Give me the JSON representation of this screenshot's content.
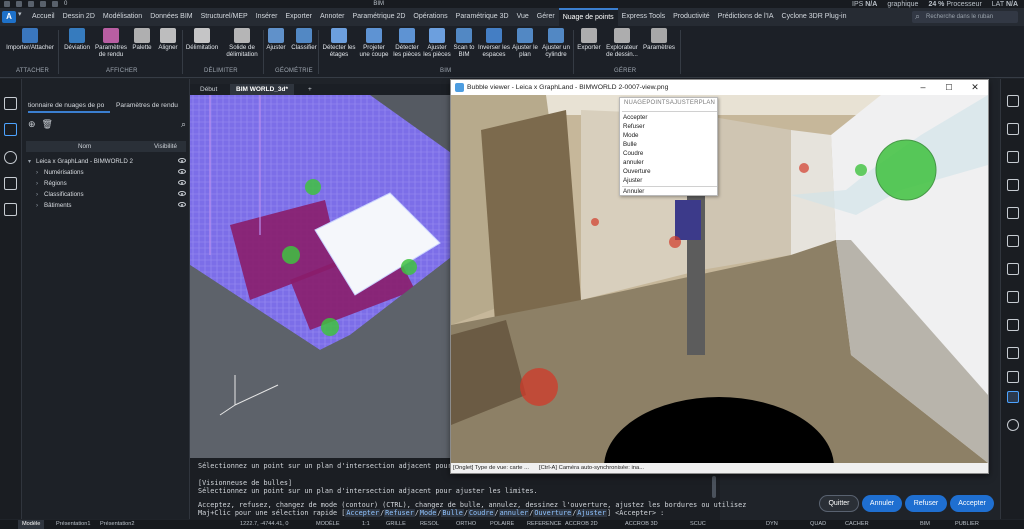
{
  "app": {
    "file_label": "BIM",
    "quick_access_value": "0",
    "top_right_fps": "IPS",
    "top_right_na": "N/A",
    "top_right_graphic": "graphique",
    "processor_label": "Processeur",
    "processor_pct": "24 %",
    "lat_label": "LAT",
    "lat_value": "N/A"
  },
  "ribbon_tabs": [
    "Accueil",
    "Dessin 2D",
    "Modélisation",
    "Données BIM",
    "Structurel/MEP",
    "Insérer",
    "Exporter",
    "Annoter",
    "Paramétrique 2D",
    "Opérations",
    "Paramétrique 3D",
    "Vue",
    "Gérer",
    "Nuage de points",
    "Express Tools",
    "Productivité",
    "Prédictions de l'IA",
    "Cyclone 3DR Plug-in"
  ],
  "active_tab": "Nuage de points",
  "search_placeholder": "Recherche dans le ruban",
  "ribbon": {
    "tools": [
      {
        "label": "Importer/Attacher"
      },
      {
        "label": "Déviation"
      },
      {
        "label": "Paramètres de rendu"
      },
      {
        "label": "Palette"
      },
      {
        "label": "Aligner"
      },
      {
        "label": "Délimitation"
      },
      {
        "label": "Solide de délimitation"
      },
      {
        "label": "Ajuster"
      },
      {
        "label": "Classifier"
      },
      {
        "label": "Détecter les étages"
      },
      {
        "label": "Projeter une coupe"
      },
      {
        "label": "Détecter les pièces"
      },
      {
        "label": "Ajuster les pièces"
      },
      {
        "label": "Scan to BIM"
      },
      {
        "label": "Inverser les espaces"
      },
      {
        "label": "Ajuster le plan"
      },
      {
        "label": "Ajuster un cylindre"
      },
      {
        "label": "Exporter"
      },
      {
        "label": "Explorateur de dessin..."
      },
      {
        "label": "Paramètres"
      }
    ],
    "groups": [
      "ATTACHER",
      "AFFICHER",
      "DÉLIMITER",
      "GÉOMÉTRIE",
      "BIM",
      "GÉRER"
    ]
  },
  "panel": {
    "tabs": [
      "tionnaire de nuages de po",
      "Paramètres de rendu"
    ],
    "columns": [
      "Nom",
      "Visibilité"
    ],
    "tree": [
      {
        "label": "Leica x GraphLand - BIMWORLD 2",
        "level": 0
      },
      {
        "label": "Numérisations",
        "level": 1
      },
      {
        "label": "Régions",
        "level": 1
      },
      {
        "label": "Classifications",
        "level": 1
      },
      {
        "label": "Bâtiments",
        "level": 1
      }
    ]
  },
  "doc_tabs": [
    "Début",
    "BIM WORLD_3d*",
    "+"
  ],
  "bubble_viewer": {
    "title": "Bubble viewer - Leica x GraphLand - BIMWORLD 2-0007-view.png",
    "status_left": "[Onglet] Type de vue: carte ...",
    "status_right": "[Ctrl-A] Caméra auto-synchronisée: ina..."
  },
  "context_menu": {
    "title": "NUAGEPOINTSAJUSTERPLAN",
    "items": [
      "Accepter",
      "Refuser",
      "Mode",
      "Bulle",
      "Coudre",
      "annuler",
      "Ouverture",
      "Ajuster"
    ],
    "cancel": "Annuler"
  },
  "command_line": {
    "line1": "Sélectionnez un point sur un plan d'intersection adjacent pour aju",
    "line2": "[Visionneuse de bulles]",
    "line3": "Sélectionnez un point sur un plan d'intersection adjacent pour ajuster les limites.",
    "line4": "Acceptez, refusez, changez de mode (contour) (CTRL), changez de bulle, annulez, dessinez l'ouverture, ajustez les bordures ou utilisez",
    "line5_prefix": "Maj+Clic pour une sélection rapide [",
    "line5_options": [
      "Accepter",
      "Refuser",
      "Mode",
      "Bulle",
      "Coudre",
      "annuler",
      "Ouverture",
      "Ajuster"
    ],
    "line5_suffix": "] <Accepter> :"
  },
  "action_buttons": [
    "Quitter",
    "Annuler",
    "Refuser",
    "Accepter"
  ],
  "status_bar": {
    "layout_tabs": [
      "Modèle",
      "Présentation1",
      "Présentation2"
    ],
    "coords": "1222.7, -4744.41, 0",
    "items": [
      "MODÈLE",
      "1:1",
      "GRILLE",
      "RESOL",
      "ORTHO",
      "POLAIRE",
      "REFERENCE",
      "ACCROB 2D",
      "ACCROB 3D",
      "SCUC",
      "DYN",
      "QUAD",
      "CACHER",
      "BIM",
      "PUBLIER"
    ]
  },
  "colors": {
    "accent": "#1f6fd1",
    "point_cloud": "#7c6ee8",
    "marker_green": "#3fc23f",
    "marker_red": "#d23a2a"
  }
}
